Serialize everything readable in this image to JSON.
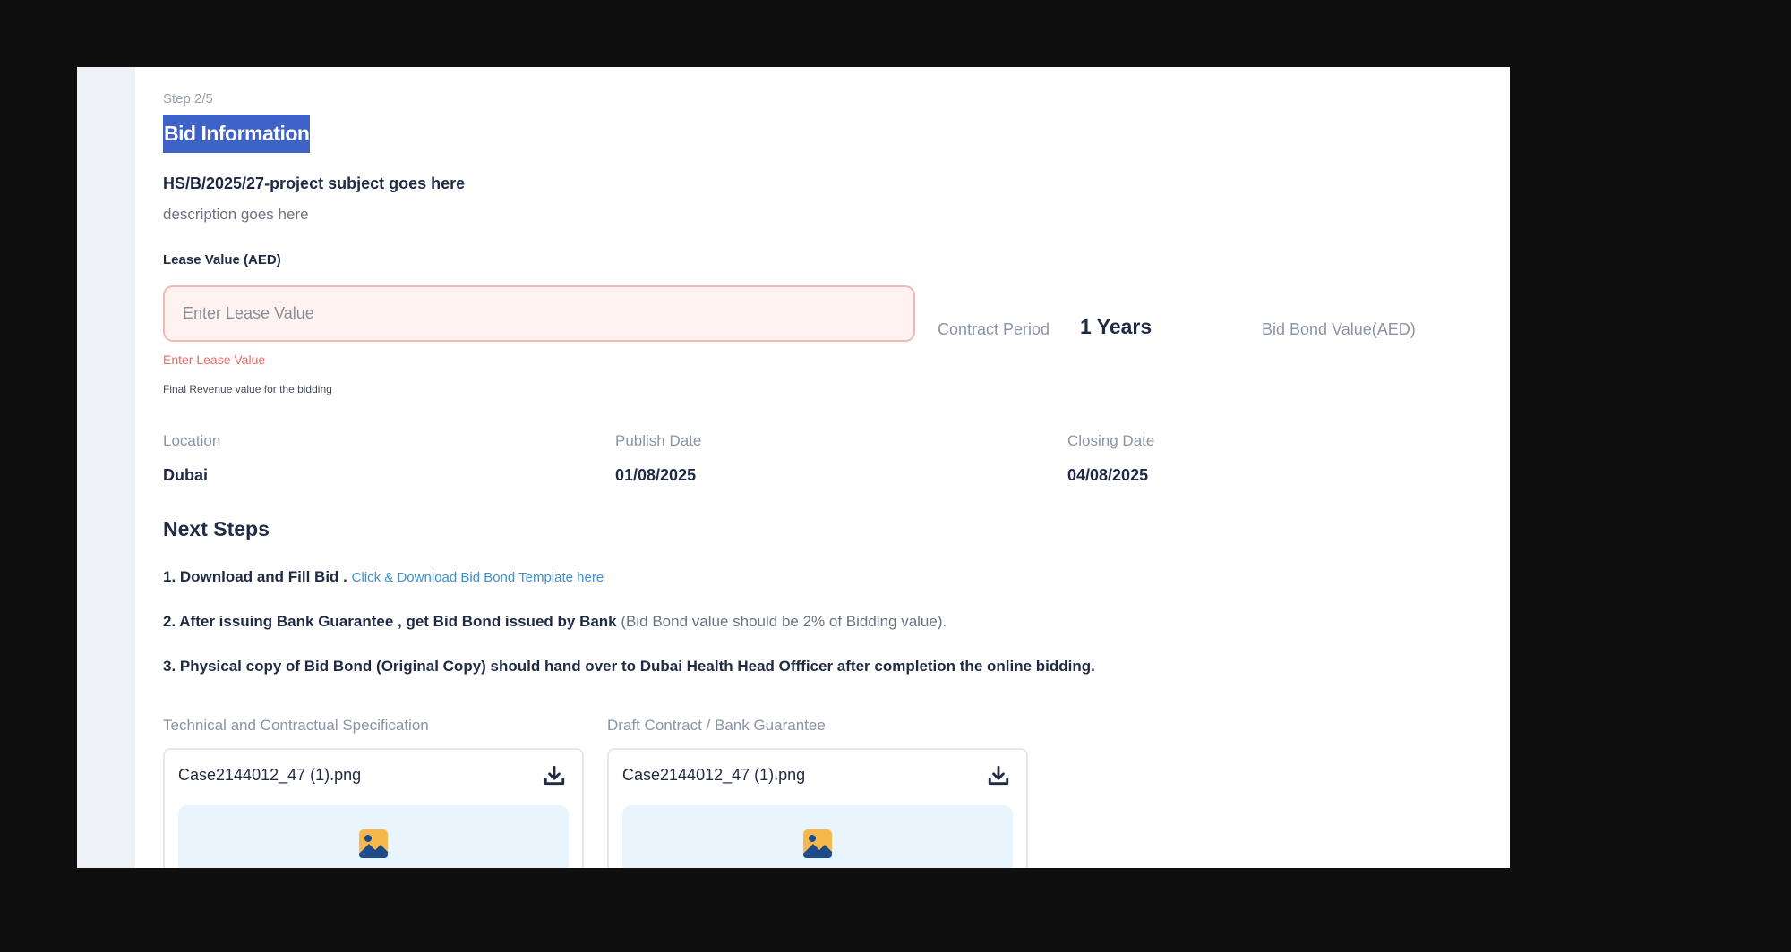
{
  "form": {
    "step": "Step 2/5",
    "title": "Bid Information",
    "project_subject": "HS/B/2025/27-project subject goes here",
    "project_description": "description goes here",
    "lease_value": {
      "label": "Lease Value (AED)",
      "placeholder": "Enter Lease Value",
      "value": "",
      "error": "Enter Lease Value",
      "hint": "Final Revenue value for the bidding"
    },
    "contract_period": {
      "label": "Contract Period",
      "value": "1 Years"
    },
    "bid_bond": {
      "label": "Bid Bond Value(AED)"
    },
    "info": {
      "location_label": "Location",
      "location_value": "Dubai",
      "publish_label": "Publish Date",
      "publish_value": "01/08/2025",
      "closing_label": "Closing Date",
      "closing_value": "04/08/2025"
    }
  },
  "next_steps": {
    "title": "Next Steps",
    "step1_text": "1. Download and Fill Bid .",
    "step1_link": "Click & Download Bid Bond Template here",
    "step2_text": "2. After issuing Bank Guarantee , get Bid Bond issued by Bank",
    "step2_note": "(Bid Bond value should be 2% of Bidding value).",
    "step3_text": "3. Physical copy of Bid Bond (Original Copy) should hand over to Dubai Health Head Offficer after completion the online bidding."
  },
  "documents": [
    {
      "heading": "Technical and Contractual Specification",
      "filename": "Case2144012_47 (1).png",
      "icon": "download-icon",
      "preview_icon": "image-icon"
    },
    {
      "heading": "Draft Contract / Bank Guarantee",
      "filename": "Case2144012_47 (1).png",
      "icon": "download-icon",
      "preview_icon": "image-icon"
    }
  ],
  "colors": {
    "title_highlight": "#3d63c9",
    "text_primary": "#1f2a44",
    "text_muted": "#8a94a6",
    "error": "#e66b63",
    "link": "#3b8fd6",
    "input_error_bg": "#fff2f1",
    "input_error_border": "#f2b8b5",
    "preview_bg": "#eaf4fc",
    "image_icon_bg": "#f6b84a",
    "image_icon_fg": "#1e4a8a"
  }
}
